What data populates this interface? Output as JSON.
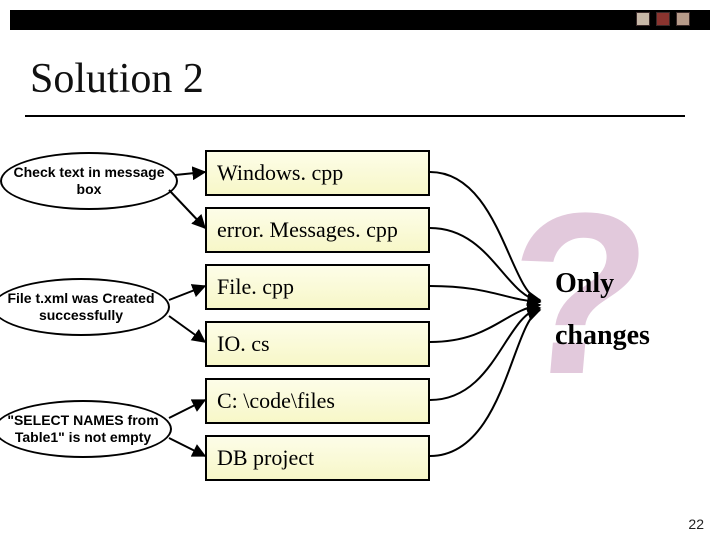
{
  "slide": {
    "title": "Solution 2",
    "page_number": "22"
  },
  "ovals": [
    {
      "text": "Check text in message box"
    },
    {
      "text": "File t.xml was Created successfully"
    },
    {
      "text": "\"SELECT NAMES from Table1\" is not empty"
    }
  ],
  "boxes": [
    "Windows. cpp",
    "error. Messages. cpp",
    "File. cpp",
    "IO. cs",
    "C: \\code\\files",
    "DB project"
  ],
  "right_labels": {
    "line1": "Only",
    "line2": "changes"
  },
  "decor": {
    "question_mark": "?"
  }
}
